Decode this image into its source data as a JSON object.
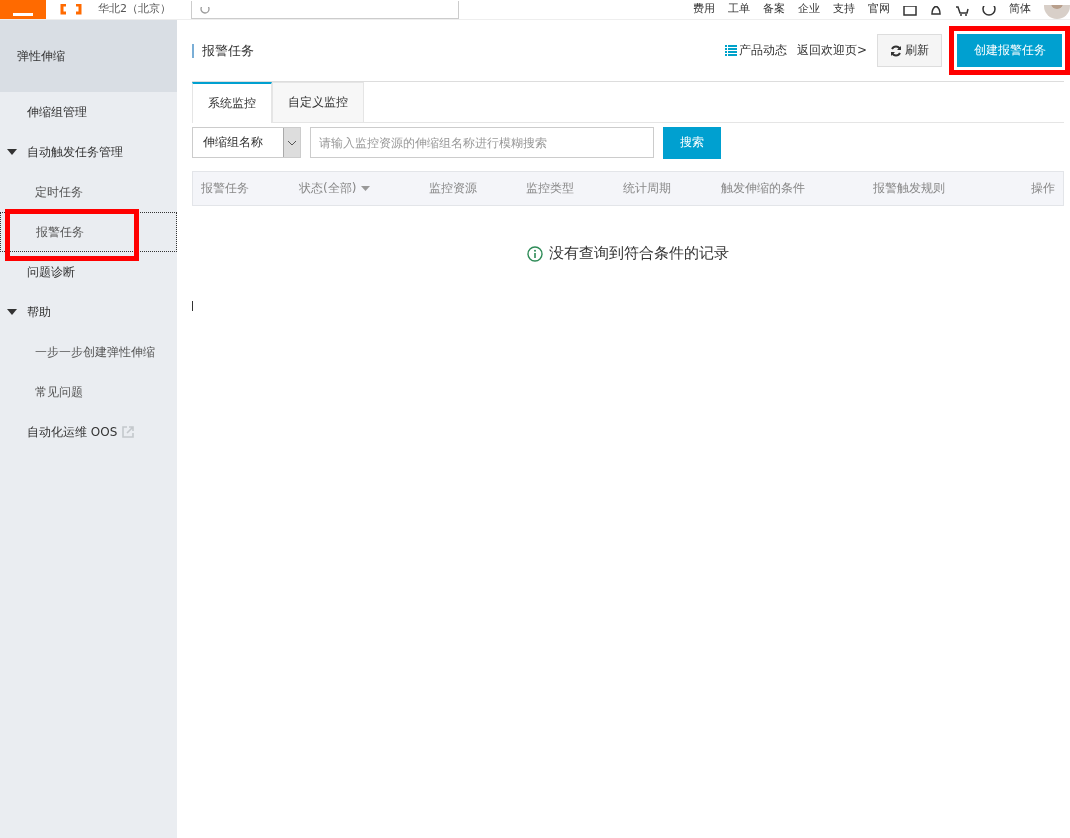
{
  "topbar": {
    "region": "华北2（北京）",
    "nav": [
      "费用",
      "工单",
      "备案",
      "企业",
      "支持",
      "官网"
    ],
    "language": "简体"
  },
  "sidebar": {
    "title": "弹性伸缩",
    "items": [
      {
        "kind": "item",
        "label": "伸缩组管理",
        "selected": false,
        "highlighted": false
      },
      {
        "kind": "group",
        "label": "自动触发任务管理",
        "expanded": true,
        "children": [
          {
            "label": "定时任务",
            "selected": false,
            "highlighted": false
          },
          {
            "label": "报警任务",
            "selected": true,
            "highlighted": true
          }
        ]
      },
      {
        "kind": "item",
        "label": "问题诊断",
        "selected": false,
        "highlighted": false
      },
      {
        "kind": "group",
        "label": "帮助",
        "expanded": true,
        "children": [
          {
            "label": "一步一步创建弹性伸缩",
            "selected": false,
            "highlighted": false
          },
          {
            "label": "常见问题",
            "selected": false,
            "highlighted": false
          }
        ]
      },
      {
        "kind": "external",
        "label": "自动化运维 OOS",
        "selected": false,
        "highlighted": false
      }
    ]
  },
  "page": {
    "title": "报警任务",
    "links": [
      "产品动态",
      "返回欢迎页>"
    ],
    "refresh_button": "刷新",
    "create_button": {
      "label": "创建报警任务",
      "highlighted": true
    }
  },
  "tabs": [
    {
      "label": "系统监控",
      "selected": true
    },
    {
      "label": "自定义监控",
      "selected": false
    }
  ],
  "filter": {
    "select": "伸缩组名称",
    "placeholder": "请输入监控资源的伸缩组名称进行模糊搜索",
    "button": "搜索"
  },
  "table": {
    "columns": [
      {
        "label": "报警任务",
        "sortable": false
      },
      {
        "label": "状态(全部)",
        "sortable": true
      },
      {
        "label": "监控资源",
        "sortable": false
      },
      {
        "label": "监控类型",
        "sortable": false
      },
      {
        "label": "统计周期",
        "sortable": false
      },
      {
        "label": "触发伸缩的条件",
        "sortable": false
      },
      {
        "label": "报警触发规则",
        "sortable": false
      },
      {
        "label": "操作",
        "sortable": false
      }
    ],
    "empty_message": "没有查询到符合条件的记录"
  }
}
